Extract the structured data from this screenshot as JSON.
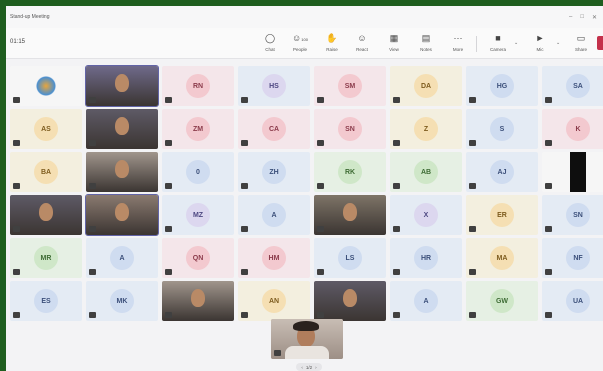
{
  "window": {
    "title": "Stand-up Meeting"
  },
  "toolbar": {
    "timer": "01:15",
    "items": [
      {
        "label": "Chat",
        "icon": "chat-icon"
      },
      {
        "label": "People",
        "icon": "people-icon",
        "count": "100"
      },
      {
        "label": "Raise",
        "icon": "raise-hand-icon"
      },
      {
        "label": "React",
        "icon": "react-icon"
      },
      {
        "label": "View",
        "icon": "view-icon"
      },
      {
        "label": "Notes",
        "icon": "notes-icon"
      },
      {
        "label": "More",
        "icon": "more-icon"
      },
      {
        "label": "Camera",
        "icon": "camera-icon"
      },
      {
        "label": "Mic",
        "icon": "mic-icon"
      },
      {
        "label": "Share",
        "icon": "share-icon"
      }
    ]
  },
  "participants": [
    {
      "initials": "",
      "kind": "logo"
    },
    {
      "initials": "",
      "kind": "video"
    },
    {
      "initials": "RN",
      "color": "pink"
    },
    {
      "initials": "HS",
      "color": "lav"
    },
    {
      "initials": "SM",
      "color": "pink"
    },
    {
      "initials": "DA",
      "color": "yellow"
    },
    {
      "initials": "HG",
      "color": "blue"
    },
    {
      "initials": "SA",
      "color": "blue"
    },
    {
      "initials": "AS",
      "color": "yellow"
    },
    {
      "initials": "",
      "kind": "video"
    },
    {
      "initials": "ZM",
      "color": "pink"
    },
    {
      "initials": "CA",
      "color": "pink"
    },
    {
      "initials": "SN",
      "color": "pink"
    },
    {
      "initials": "Z",
      "color": "yellow"
    },
    {
      "initials": "S",
      "color": "blue"
    },
    {
      "initials": "K",
      "color": "pink"
    },
    {
      "initials": "BA",
      "color": "yellow"
    },
    {
      "initials": "",
      "kind": "video"
    },
    {
      "initials": "0",
      "color": "blue"
    },
    {
      "initials": "ZH",
      "color": "blue"
    },
    {
      "initials": "RK",
      "color": "green"
    },
    {
      "initials": "AB",
      "color": "green"
    },
    {
      "initials": "AJ",
      "color": "blue"
    },
    {
      "initials": "",
      "kind": "video-dark"
    },
    {
      "initials": "",
      "kind": "video"
    },
    {
      "initials": "",
      "kind": "video"
    },
    {
      "initials": "MZ",
      "color": "lav"
    },
    {
      "initials": "A",
      "color": "blue"
    },
    {
      "initials": "",
      "kind": "video"
    },
    {
      "initials": "X",
      "color": "lav"
    },
    {
      "initials": "ER",
      "color": "yellow"
    },
    {
      "initials": "SN",
      "color": "blue"
    },
    {
      "initials": "MR",
      "color": "green"
    },
    {
      "initials": "A",
      "color": "blue"
    },
    {
      "initials": "QN",
      "color": "pink"
    },
    {
      "initials": "HM",
      "color": "pink"
    },
    {
      "initials": "LS",
      "color": "blue"
    },
    {
      "initials": "HR",
      "color": "blue"
    },
    {
      "initials": "MA",
      "color": "yellow"
    },
    {
      "initials": "NF",
      "color": "blue"
    },
    {
      "initials": "ES",
      "color": "blue"
    },
    {
      "initials": "MK",
      "color": "blue"
    },
    {
      "initials": "",
      "kind": "video"
    },
    {
      "initials": "AN",
      "color": "yellow"
    },
    {
      "initials": "",
      "kind": "video"
    },
    {
      "initials": "A",
      "color": "blue"
    },
    {
      "initials": "GW",
      "color": "green"
    },
    {
      "initials": "UA",
      "color": "blue"
    }
  ],
  "pager": {
    "label": "1/2"
  },
  "colors": {
    "frame": "#1f5e1f",
    "leave": "#c4314b",
    "selected": "#6264a7"
  }
}
